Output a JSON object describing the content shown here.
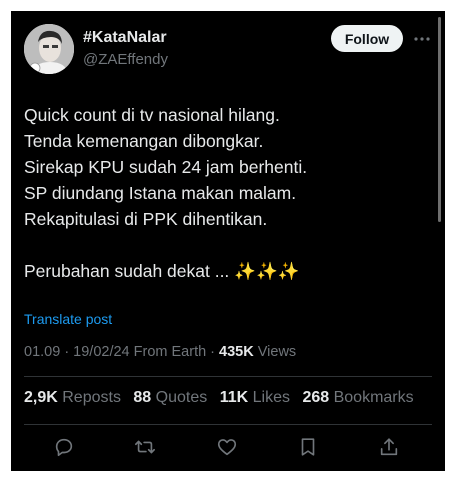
{
  "post": {
    "display_name": "#KataNalar",
    "handle": "@ZAEffendy",
    "follow_label": "Follow",
    "body_lines": [
      "Quick count di tv nasional hilang.",
      "Tenda kemenangan dibongkar.",
      "Sirekap KPU sudah 24 jam berhenti.",
      "SP diundang Istana makan malam.",
      "Rekapitulasi di PPK dihentikan."
    ],
    "closing_line": "Perubahan sudah dekat ... ",
    "closing_emoji": "✨✨✨",
    "translate_label": "Translate post",
    "meta": {
      "timestamp": "01.09 · 19/02/24 From Earth · ",
      "views_count": "435K",
      "views_label": " Views"
    },
    "stats": {
      "reposts_count": "2,9K",
      "reposts_label": "Reposts",
      "quotes_count": "88",
      "quotes_label": "Quotes",
      "likes_count": "11K",
      "likes_label": "Likes",
      "bookmarks_count": "268",
      "bookmarks_label": "Bookmarks"
    }
  },
  "actions": [
    "reply-icon",
    "repost-icon",
    "like-icon",
    "bookmark-icon",
    "share-icon"
  ],
  "colors": {
    "background": "#000000",
    "text": "#e7e9ea",
    "muted": "#71767b",
    "link": "#1d9bf0",
    "divider": "#2f3336",
    "button_bg": "#eff3f4"
  }
}
